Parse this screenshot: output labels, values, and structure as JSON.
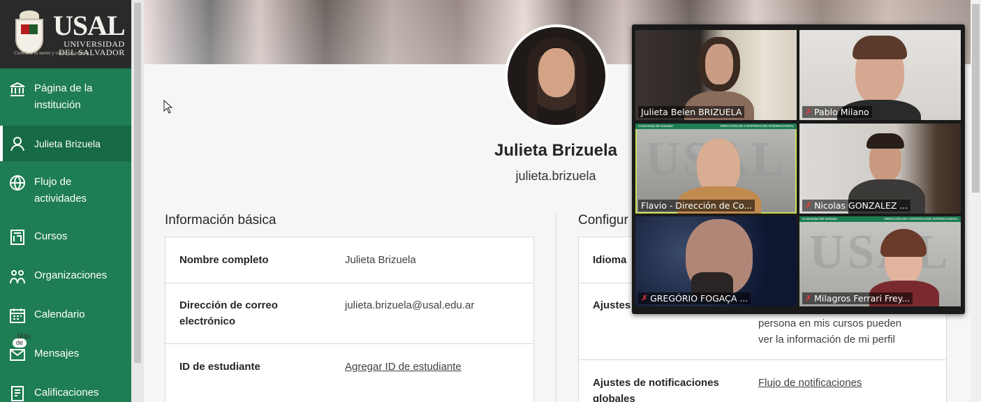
{
  "sidebar": {
    "logo": {
      "title": "USAL",
      "line1": "UNIVERSIDAD",
      "line2": "DEL SALVADOR",
      "motto": "Ciencia a la mente y virtud al corazón"
    },
    "items": [
      {
        "label": "Página de la institución",
        "icon": "institution-icon"
      },
      {
        "label": "Julieta Brizuela",
        "icon": "user-icon",
        "active": true
      },
      {
        "label": "Flujo de actividades",
        "icon": "globe-icon"
      },
      {
        "label": "Cursos",
        "icon": "courses-icon"
      },
      {
        "label": "Organizaciones",
        "icon": "organizations-icon"
      },
      {
        "label": "Calendario",
        "icon": "calendar-icon"
      },
      {
        "label": "Mensajes",
        "icon": "mail-icon",
        "badge": "de",
        "badge_top": "Más",
        "badge_bottom": "99"
      },
      {
        "label": "Calificaciones",
        "icon": "grades-icon"
      }
    ]
  },
  "profile": {
    "name": "Julieta Brizuela",
    "username": "julieta.brizuela"
  },
  "basic_info": {
    "title": "Información básica",
    "rows": [
      {
        "key": "Nombre completo",
        "value": "Julieta Brizuela",
        "link": false
      },
      {
        "key": "Dirección de correo electrónico",
        "value": "julieta.brizuela@usal.edu.ar",
        "link": false
      },
      {
        "key": "ID de estudiante",
        "value": "Agregar ID de estudiante",
        "link": true
      }
    ]
  },
  "config": {
    "title": "Configur",
    "rows": [
      {
        "key": "Idioma",
        "value": ""
      },
      {
        "key": "Ajustes",
        "value": "persona en mis cursos pueden ver la información de mi perfil"
      },
      {
        "key": "Ajustes de notificaciones globales",
        "value": "Flujo de notificaciones",
        "link": true
      }
    ]
  },
  "video_call": {
    "participants": [
      {
        "name": "Julieta Belen BRIZUELA",
        "muted": false
      },
      {
        "name": "Pablo Milano",
        "muted": true
      },
      {
        "name": "Flavio - Dirección de Co...",
        "muted": false,
        "active": true
      },
      {
        "name": "Nicolas GONZALEZ ...",
        "muted": true
      },
      {
        "name": "GREGÓRIO FOGAÇA ...",
        "muted": true
      },
      {
        "name": "Milagros Ferrari Frey...",
        "muted": true
      }
    ],
    "bg_strip_left": "Universidad del Salvador",
    "bg_strip_right": "DIRECCIÓN DE COOPERACIÓN INTERNACIONAL",
    "bg_logo": "USAL"
  },
  "colors": {
    "sidebar": "#1e7d52",
    "active": "#166a44",
    "link": "#1a7498",
    "active_tile": "#c8e05a",
    "muted": "#e23a3a"
  }
}
